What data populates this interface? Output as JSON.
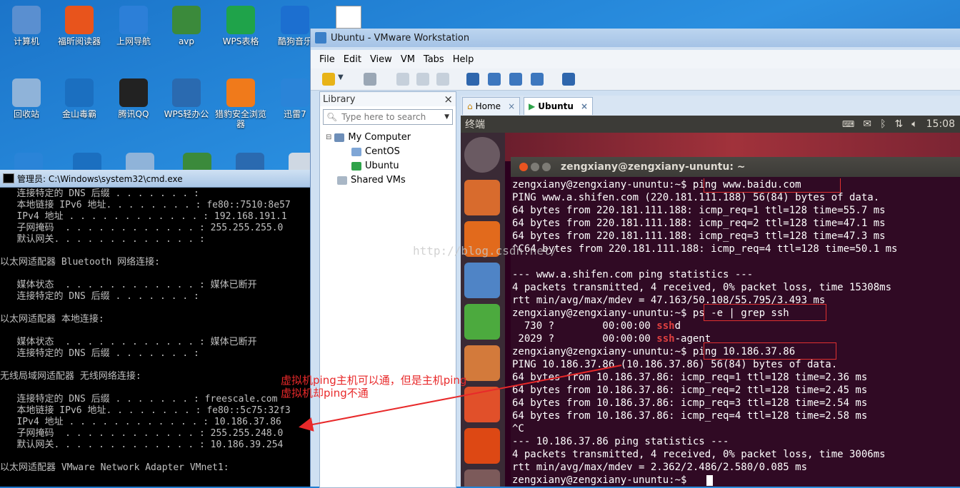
{
  "desktop": {
    "icons": [
      {
        "label": "计算机",
        "color": "#5a8fd0"
      },
      {
        "label": "福昕阅读器",
        "color": "#e8541c"
      },
      {
        "label": "上网导航",
        "color": "#2c7fd8"
      },
      {
        "label": "avp",
        "color": "#3b8a3b"
      },
      {
        "label": "WPS表格",
        "color": "#1fa34a"
      },
      {
        "label": "酷狗音乐",
        "color": "#1c6fd0"
      },
      {
        "label": "回收站",
        "color": "#8fb3d9"
      },
      {
        "label": "金山毒霸",
        "color": "#1b6fc0"
      },
      {
        "label": "腾讯QQ",
        "color": "#222222"
      },
      {
        "label": "WPS轻办公",
        "color": "#2a6ab0"
      },
      {
        "label": "猎豹安全浏览器",
        "color": "#f07a1b"
      },
      {
        "label": "迅雷7",
        "color": "#2a84d8"
      }
    ]
  },
  "cmd": {
    "title": "管理员: C:\\Windows\\system32\\cmd.exe",
    "lines": [
      "   连接特定的 DNS 后缀 . . . . . . . :",
      "   本地链接 IPv6 地址. . . . . . . . : fe80::7510:8e57",
      "   IPv4 地址 . . . . . . . . . . . . : 192.168.191.1",
      "   子网掩码  . . . . . . . . . . . . : 255.255.255.0",
      "   默认网关. . . . . . . . . . . . . :",
      "",
      "以太网适配器 Bluetooth 网络连接:",
      "",
      "   媒体状态  . . . . . . . . . . . . : 媒体已断开",
      "   连接特定的 DNS 后缀 . . . . . . . :",
      "",
      "以太网适配器 本地连接:",
      "",
      "   媒体状态  . . . . . . . . . . . . : 媒体已断开",
      "   连接特定的 DNS 后缀 . . . . . . . :",
      "",
      "无线局域网适配器 无线网络连接:",
      "",
      "   连接特定的 DNS 后缀 . . . . . . . : freescale.com",
      "   本地链接 IPv6 地址. . . . . . . . : fe80::5c75:32f3",
      "   IPv4 地址 . . . . . . . . . . . . : 10.186.37.86",
      "   子网掩码  . . . . . . . . . . . . : 255.255.248.0",
      "   默认网关. . . . . . . . . . . . . : 10.186.39.254",
      "",
      "以太网适配器 VMware Network Adapter VMnet1:"
    ]
  },
  "vmware": {
    "title": "Ubuntu - VMware Workstation",
    "menu": [
      "File",
      "Edit",
      "View",
      "VM",
      "Tabs",
      "Help"
    ],
    "library": {
      "title": "Library",
      "close": "×",
      "search_placeholder": "Type here to search",
      "tree": [
        "My Computer",
        "CentOS",
        "Ubuntu",
        "Shared VMs"
      ]
    },
    "tabs": [
      {
        "label": "Home",
        "close": "×"
      },
      {
        "label": "Ubuntu",
        "close": "×"
      }
    ]
  },
  "ubuntu": {
    "panel_title": "终端",
    "time": "15:08",
    "terminal_title": "zengxiany@zengxiany-ununtu: ~",
    "lines": [
      "zengxiany@zengxiany-ununtu:~$ ping www.baidu.com",
      "PING www.a.shifen.com (220.181.111.188) 56(84) bytes of data.",
      "64 bytes from 220.181.111.188: icmp_req=1 ttl=128 time=55.7 ms",
      "64 bytes from 220.181.111.188: icmp_req=2 ttl=128 time=47.1 ms",
      "64 bytes from 220.181.111.188: icmp_req=3 ttl=128 time=47.3 ms",
      "^C64 bytes from 220.181.111.188: icmp_req=4 ttl=128 time=50.1 ms",
      "",
      "--- www.a.shifen.com ping statistics ---",
      "4 packets transmitted, 4 received, 0% packet loss, time 15308ms",
      "rtt min/avg/max/mdev = 47.163/50.108/55.795/3.493 ms",
      "zengxiany@zengxiany-ununtu:~$ ps -e | grep ssh",
      "",
      "",
      "zengxiany@zengxiany-ununtu:~$ ping 10.186.37.86",
      "PING 10.186.37.86 (10.186.37.86) 56(84) bytes of data.",
      "64 bytes from 10.186.37.86: icmp_req=1 ttl=128 time=2.36 ms",
      "64 bytes from 10.186.37.86: icmp_req=2 ttl=128 time=2.45 ms",
      "64 bytes from 10.186.37.86: icmp_req=3 ttl=128 time=2.54 ms",
      "64 bytes from 10.186.37.86: icmp_req=4 ttl=128 time=2.58 ms",
      "^C",
      "--- 10.186.37.86 ping statistics ---",
      "4 packets transmitted, 4 received, 0% packet loss, time 3006ms",
      "rtt min/avg/max/mdev = 2.362/2.486/2.580/0.085 ms",
      "zengxiany@zengxiany-ununtu:~$ "
    ],
    "ssh_rows": [
      {
        "pre": "  730 ?        00:00:00 ",
        "hl": "ssh",
        "post": "d"
      },
      {
        "pre": " 2029 ?        00:00:00 ",
        "hl": "ssh",
        "post": "-agent"
      }
    ]
  },
  "annotation": {
    "line1": "虚拟机ping主机可以通，但是主机ping",
    "line2": "虚拟机却ping不通",
    "color": "#e8292a"
  },
  "watermark": "http://blog.csdn.net/"
}
